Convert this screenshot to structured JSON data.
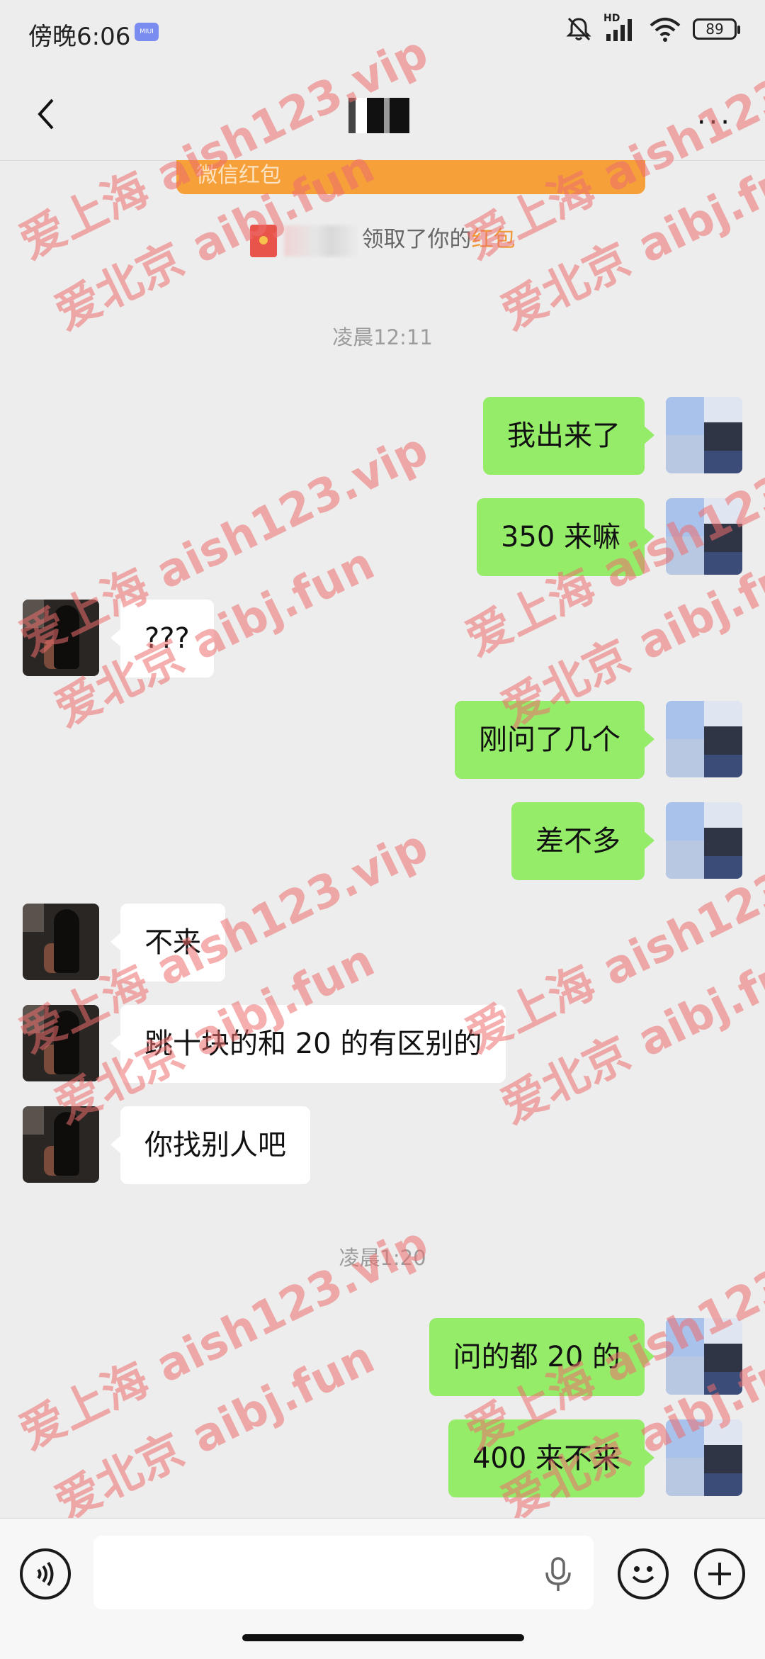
{
  "status_bar": {
    "time": "傍晚6:06",
    "miui_badge": "MIUI",
    "network_label": "HD",
    "battery": "89",
    "icons": [
      "silent-icon",
      "signal-icon",
      "wifi-icon",
      "battery-icon"
    ]
  },
  "header": {
    "back_icon": "chevron-left-icon",
    "more_label": "···"
  },
  "banner": {
    "text": "微信红包"
  },
  "system_note": {
    "prefix": "领取了你的",
    "highlight": "红包"
  },
  "timestamps": [
    "凌晨12:11",
    "凌晨1:20"
  ],
  "messages": [
    {
      "from": "me",
      "text": "我出来了"
    },
    {
      "from": "me",
      "text": "350 来嘛"
    },
    {
      "from": "her",
      "text": "???"
    },
    {
      "from": "me",
      "text": "刚问了几个"
    },
    {
      "from": "me",
      "text": "差不多"
    },
    {
      "from": "her",
      "text": "不来"
    },
    {
      "from": "her",
      "text": "跳十块的和 20 的有区别的"
    },
    {
      "from": "her",
      "text": "你找别人吧"
    },
    {
      "from": "me",
      "text": "问的都 20 的"
    },
    {
      "from": "me",
      "text": "400 来不来"
    }
  ],
  "input_bar": {
    "voice_icon": "voice-icon",
    "mic_icon": "mic-icon",
    "emoji_icon": "emoji-icon",
    "plus_icon": "plus-icon"
  },
  "watermarks": [
    "爱上海 aish123.vip",
    "爱北京 aibj.fun"
  ],
  "colors": {
    "background": "#ededed",
    "my_bubble": "#95ec69",
    "her_bubble": "#ffffff",
    "banner": "#f6a03a",
    "watermark": "#ec6e6e"
  }
}
